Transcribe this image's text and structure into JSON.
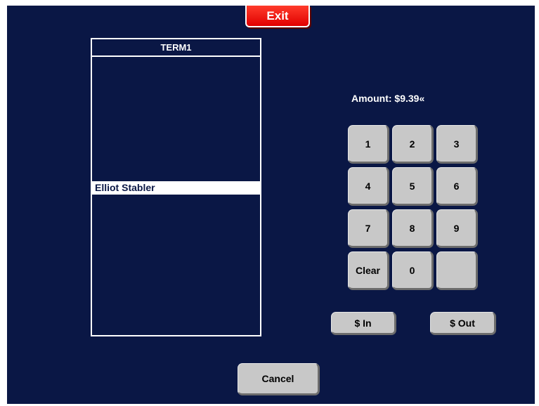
{
  "header": {
    "exit_label": "Exit"
  },
  "panel": {
    "title": "TERM1",
    "items": [
      {
        "label": "Elliot Stabler",
        "selected": true
      }
    ]
  },
  "amount": {
    "text": "Amount: $9.39«"
  },
  "keypad": {
    "keys": [
      "1",
      "2",
      "3",
      "4",
      "5",
      "6",
      "7",
      "8",
      "9",
      "Clear",
      "0",
      ""
    ]
  },
  "actions": {
    "cash_in_label": "$ In",
    "cash_out_label": "$ Out",
    "cancel_label": "Cancel"
  },
  "colors": {
    "background": "#0a1745",
    "exit_button": "#ff1a0a",
    "keypad_button": "#c8c8c8",
    "selected_row": "#ffffff"
  }
}
